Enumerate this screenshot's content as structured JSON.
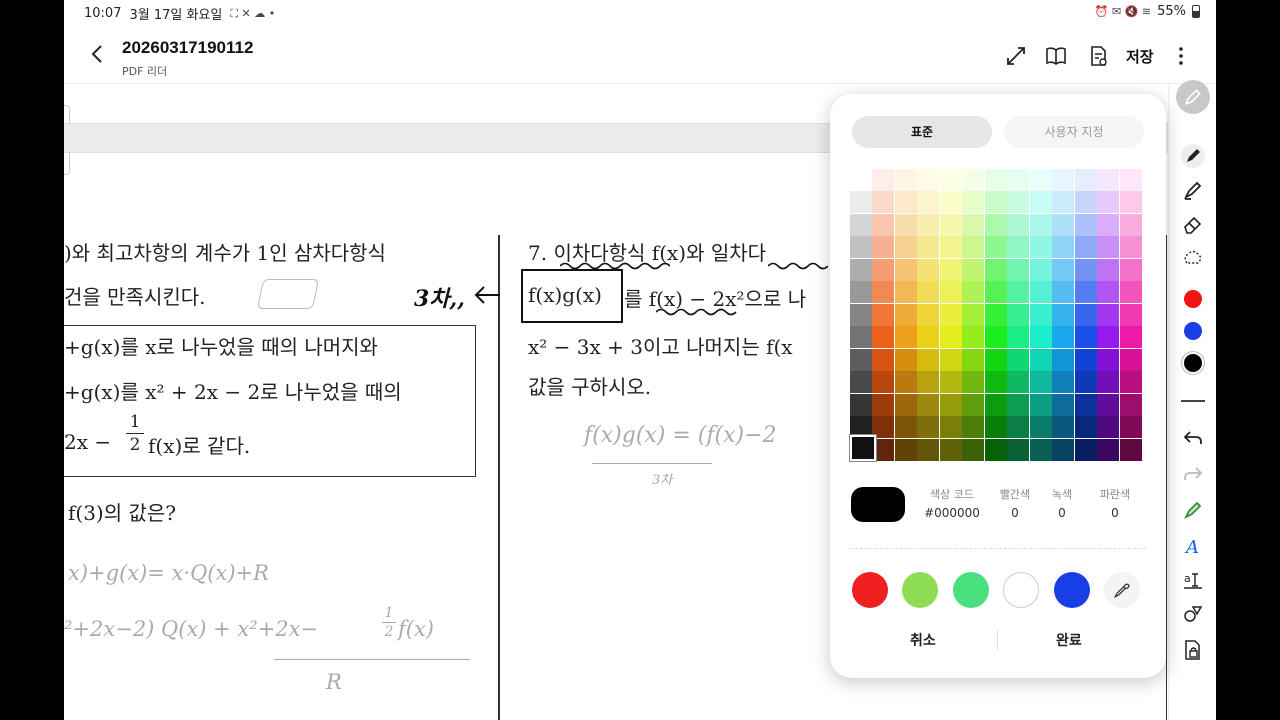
{
  "status": {
    "time": "10:07",
    "date": "3월 17일 화요일",
    "battery": "55%"
  },
  "header": {
    "title": "20260317190112",
    "subtitle": "PDF 리더",
    "save_label": "저장"
  },
  "document": {
    "left_lines": [
      ")와 최고차항의 계수가 1인 삼차다항식",
      "건을 만족시킨다.",
      "+g(x)를 x로 나누었을 때의 나머지와",
      "+g(x)를  x² + 2x − 2로 나누었을 때의",
      "2x − ",
      "f(x)로 같다.",
      "f(3)의 값은?"
    ],
    "left_fraction": {
      "numerator": "1",
      "denominator": "2"
    },
    "right_lines": [
      "7. 이차다항식 f(x)와 일차다",
      "f(x)g(x)",
      "를  f(x) − 2x²으로 나",
      "x² − 3x + 3이고 나머지는 f(x",
      "값을 구하시오."
    ],
    "handwriting": [
      "3차,,",
      "f(x)g(x) = (f(x)−2",
      "3차",
      "x)+g(x)= x·Q(x)+R",
      "²+2x−2) Q(x) + x²+2x−",
      "f(x)",
      "R"
    ],
    "hand_fraction": {
      "numerator": "1",
      "denominator": "2"
    }
  },
  "picker": {
    "tab_standard": "표준",
    "tab_custom": "사용자 지정",
    "code_label": "색상 코드",
    "code_value": "#000000",
    "red_label": "빨간색",
    "red_value": "0",
    "green_label": "녹색",
    "green_value": "0",
    "blue_label": "파란색",
    "blue_value": "0",
    "cancel_label": "취소",
    "done_label": "완료",
    "presets": [
      "#f02020",
      "#8edb55",
      "#4be07f",
      "#ffffff",
      "#1a3ee6"
    ]
  },
  "toolbar": {
    "colors": [
      "#f01414",
      "#1a3ee6",
      "#000000"
    ]
  }
}
